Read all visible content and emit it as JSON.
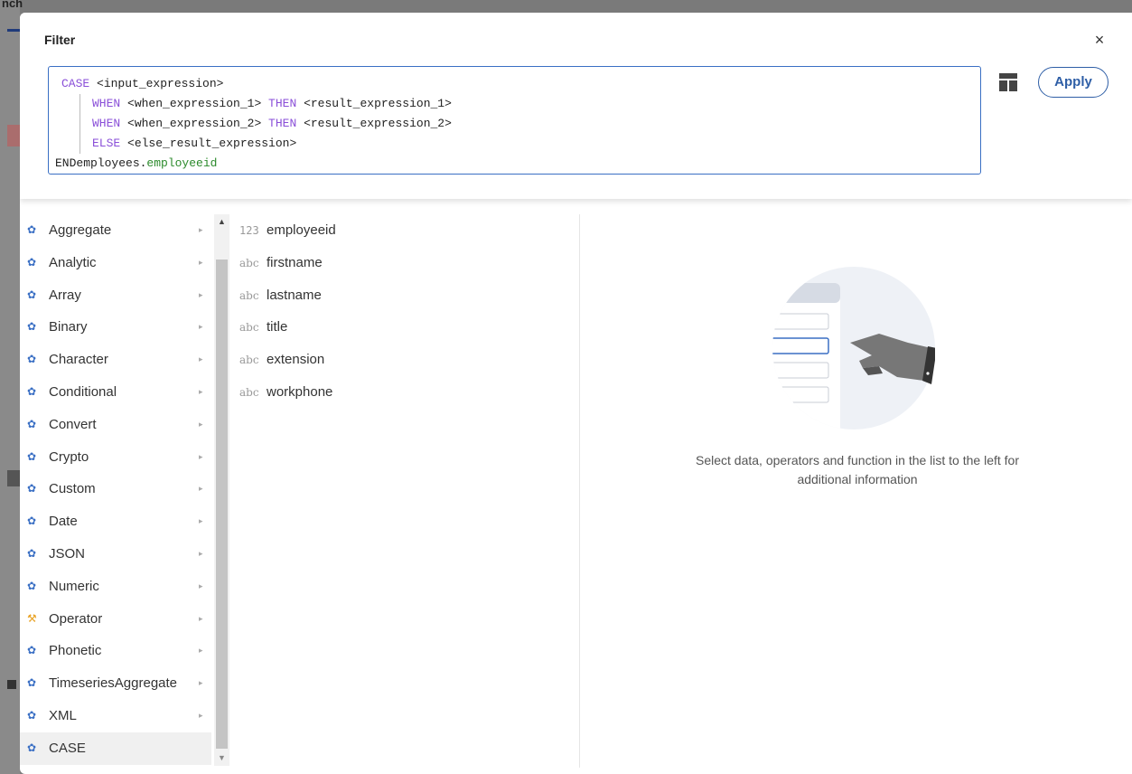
{
  "background": {
    "partial_text": "nch"
  },
  "dialog": {
    "title": "Filter",
    "close_label": "×",
    "apply_label": "Apply",
    "table_icon": "table-layout-icon",
    "accent_color": "#2e5ea6"
  },
  "editor": {
    "lines": [
      {
        "kw": "CASE",
        "text": " <input_expression>"
      },
      {
        "kw": "WHEN",
        "text": " <when_expression_1> ",
        "kw2": "THEN",
        "text2": " <result_expression_1>"
      },
      {
        "kw": "WHEN",
        "text": " <when_expression_2> ",
        "kw2": "THEN",
        "text2": " <result_expression_2>"
      },
      {
        "kw": "ELSE",
        "text": " <else_result_expression>"
      }
    ],
    "last_line_prefix": "ENDemployees.",
    "last_line_field": "employeeid"
  },
  "categories": [
    {
      "label": "Aggregate",
      "icon": "gear-icon",
      "arrow": "▸"
    },
    {
      "label": "Analytic",
      "icon": "gear-icon",
      "arrow": "▸"
    },
    {
      "label": "Array",
      "icon": "gear-icon",
      "arrow": "▸"
    },
    {
      "label": "Binary",
      "icon": "gear-icon",
      "arrow": "▸"
    },
    {
      "label": "Character",
      "icon": "gear-icon",
      "arrow": "▸"
    },
    {
      "label": "Conditional",
      "icon": "gear-icon",
      "arrow": "▸"
    },
    {
      "label": "Convert",
      "icon": "gear-icon",
      "arrow": "▸"
    },
    {
      "label": "Crypto",
      "icon": "gear-icon",
      "arrow": "▸"
    },
    {
      "label": "Custom",
      "icon": "gear-icon",
      "arrow": "▸"
    },
    {
      "label": "Date",
      "icon": "gear-icon",
      "arrow": "▸"
    },
    {
      "label": "JSON",
      "icon": "gear-icon",
      "arrow": "▸"
    },
    {
      "label": "Numeric",
      "icon": "gear-icon",
      "arrow": "▸"
    },
    {
      "label": "Operator",
      "icon": "wrench-icon",
      "arrow": "▸"
    },
    {
      "label": "Phonetic",
      "icon": "gear-icon",
      "arrow": "▸"
    },
    {
      "label": "TimeseriesAggregate",
      "icon": "gear-icon",
      "arrow": "▸"
    },
    {
      "label": "XML",
      "icon": "gear-icon",
      "arrow": "▸"
    },
    {
      "label": "CASE",
      "icon": "gear-icon",
      "arrow": ""
    }
  ],
  "fields": [
    {
      "type": "123",
      "name": "employeeid"
    },
    {
      "type": "abc",
      "name": "firstname"
    },
    {
      "type": "abc",
      "name": "lastname"
    },
    {
      "type": "abc",
      "name": "title"
    },
    {
      "type": "abc",
      "name": "extension"
    },
    {
      "type": "abc",
      "name": "workphone"
    }
  ],
  "info": {
    "illustration_icon": "hand-pointing-list-icon",
    "message": "Select data, operators and function in the list to the left for additional information"
  }
}
